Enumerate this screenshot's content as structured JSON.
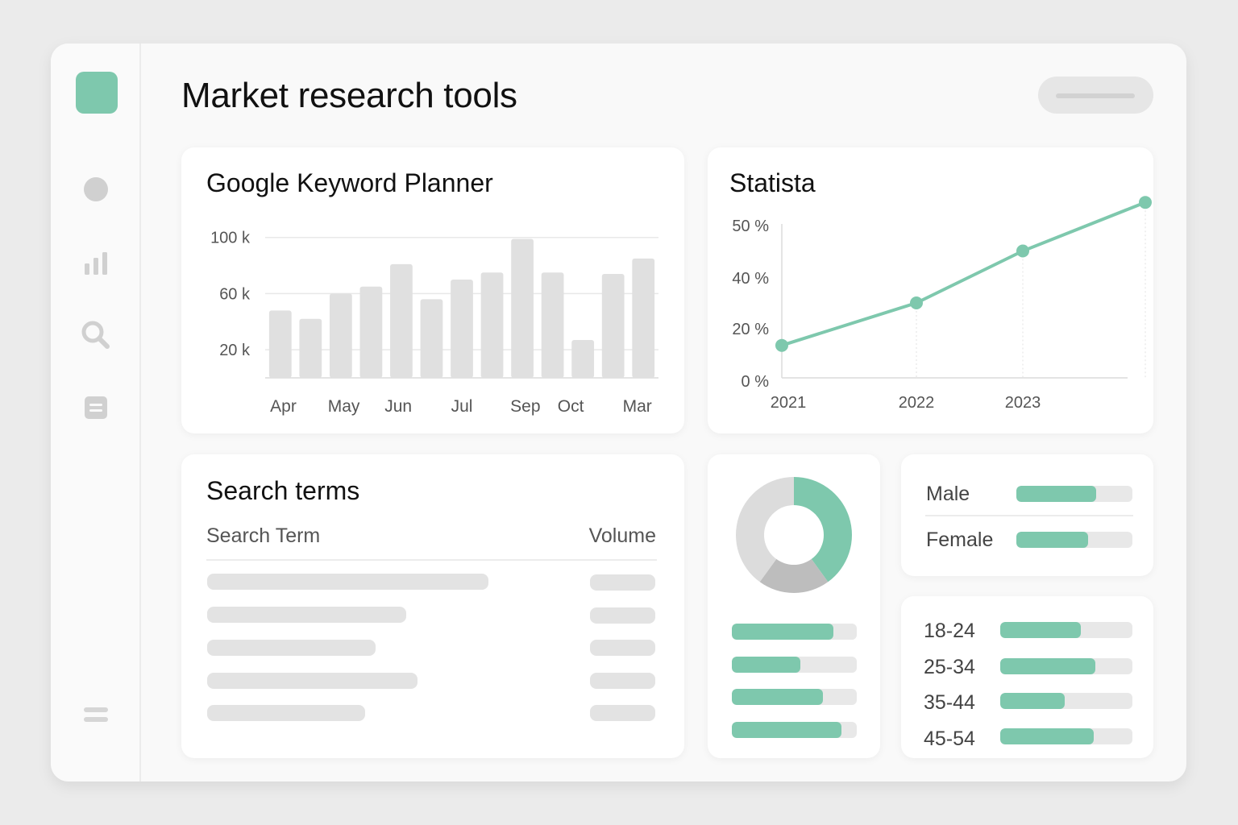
{
  "page": {
    "title": "Market research tools"
  },
  "sidebar": {
    "items": [
      {
        "icon": "circle-icon"
      },
      {
        "icon": "bar-chart-icon"
      },
      {
        "icon": "search-icon"
      },
      {
        "icon": "document-icon"
      }
    ],
    "menu_icon": "menu-icon"
  },
  "colors": {
    "accent": "#7ec8ad",
    "bar": "#e0e0e0",
    "skeleton": "#e3e3e3",
    "track": "#e8e8e8"
  },
  "keyword_planner": {
    "title": "Google Keyword Planner",
    "chart_data": {
      "type": "bar",
      "y_ticks": [
        "100 k",
        "60 k",
        "20 k"
      ],
      "y_tick_values": [
        100000,
        60000,
        20000
      ],
      "ylim": [
        0,
        105000
      ],
      "x_tick_labels": [
        "Apr",
        "May",
        "Jun",
        "Jul",
        "Sep",
        "Oct",
        "Mar"
      ],
      "values": [
        48000,
        42000,
        60000,
        65000,
        81000,
        56000,
        70000,
        75000,
        99000,
        75000,
        27000,
        74000,
        85000
      ]
    }
  },
  "statista": {
    "title": "Statista",
    "chart_data": {
      "type": "line",
      "y_ticks": [
        "50 %",
        "40 %",
        "20 %",
        "0 %"
      ],
      "y_tick_values": [
        50,
        40,
        20,
        0
      ],
      "x_tick_labels": [
        "2021",
        "2022",
        "2023"
      ],
      "x": [
        2021,
        2022,
        2023,
        2024
      ],
      "values": [
        13,
        30,
        45,
        54
      ]
    }
  },
  "search_terms": {
    "title": "Search terms",
    "col_term": "Search Term",
    "col_volume": "Volume"
  },
  "donut": {
    "chart_data": {
      "type": "pie",
      "values": [
        40,
        20,
        40
      ]
    },
    "bars": [
      0.81,
      0.55,
      0.73,
      0.88
    ]
  },
  "gender": {
    "rows": [
      {
        "label": "Male",
        "value": 0.69
      },
      {
        "label": "Female",
        "value": 0.62
      }
    ]
  },
  "age": {
    "rows": [
      {
        "label": "18-24",
        "value": 0.61
      },
      {
        "label": "25-34",
        "value": 0.72
      },
      {
        "label": "35-44",
        "value": 0.49
      },
      {
        "label": "45-54",
        "value": 0.71
      }
    ]
  }
}
